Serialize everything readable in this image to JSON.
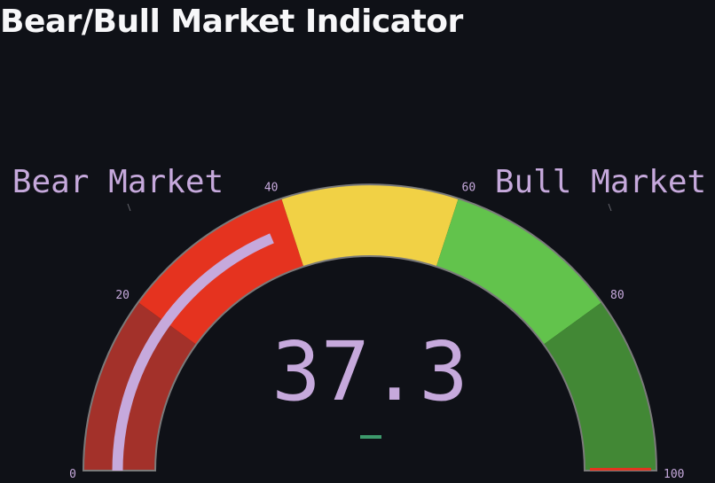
{
  "page": {
    "title": "Bear/Bull Market Indicator"
  },
  "chart_data": {
    "type": "gauge",
    "value": 37.3,
    "value_text": "37.3",
    "range": [
      0,
      100
    ],
    "ticks": [
      "0",
      "20",
      "40",
      "60",
      "80",
      "100"
    ],
    "tick_values": [
      0,
      20,
      40,
      60,
      80,
      100
    ],
    "bands": [
      {
        "from": 0,
        "to": 20,
        "color": "#a3312a"
      },
      {
        "from": 20,
        "to": 40,
        "color": "#e5331f"
      },
      {
        "from": 40,
        "to": 60,
        "color": "#f1d145"
      },
      {
        "from": 60,
        "to": 80,
        "color": "#62c34c"
      },
      {
        "from": 80,
        "to": 100,
        "color": "#428835"
      }
    ],
    "bar_color": "#c6a9dc",
    "labels": {
      "left": "Bear Market",
      "right": "Bull Market"
    },
    "label_color": "#c6a9dc",
    "text_color": "#c6a9dc",
    "delta_color": "#3d9a6c",
    "outline_color": "#7a7a7a",
    "background_color": "#0f1117"
  }
}
